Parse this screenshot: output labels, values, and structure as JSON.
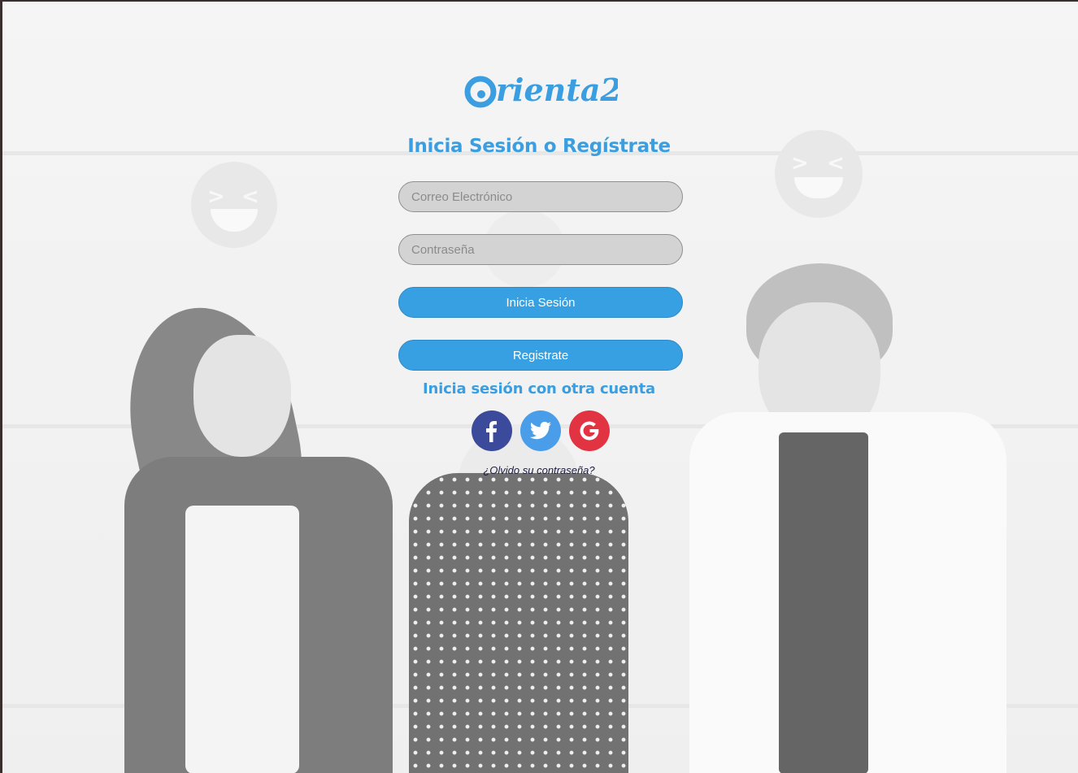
{
  "brand": {
    "logo_text": "Orienta2",
    "accent": "#3a9ee0"
  },
  "form": {
    "title": "Inicia Sesión o Regístrate",
    "email_placeholder": "Correo Electrónico",
    "password_placeholder": "Contraseña",
    "login_label": "Inicia Sesión",
    "register_label": "Registrate"
  },
  "social": {
    "heading": "Inicia sesión con otra cuenta",
    "providers": [
      {
        "name": "facebook",
        "icon": "facebook-icon",
        "color": "#3b4a9a"
      },
      {
        "name": "twitter",
        "icon": "twitter-icon",
        "color": "#4a9de8"
      },
      {
        "name": "google",
        "icon": "google-icon",
        "color": "#e23342"
      }
    ]
  },
  "forgot_password": "¿Olvido su contraseña?"
}
